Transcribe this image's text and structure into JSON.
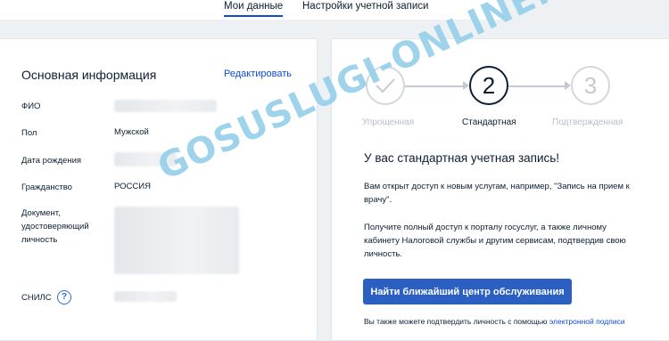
{
  "tabs": [
    {
      "label": "Мои данные",
      "active": true
    },
    {
      "label": "Настройки учетной записи",
      "active": false
    }
  ],
  "basic_info": {
    "title": "Основная информация",
    "edit_label": "Редактировать",
    "rows": [
      {
        "label": "ФИО",
        "value": ""
      },
      {
        "label": "Пол",
        "value": "Мужской"
      },
      {
        "label": "Дата рождения",
        "value": ""
      },
      {
        "label": "Гражданство",
        "value": "РОССИЯ"
      },
      {
        "label": "Документ, удостоверяющий личность",
        "value": ""
      },
      {
        "label": "СНИЛС",
        "value": ""
      }
    ],
    "help_glyph": "?"
  },
  "account_level": {
    "steps": [
      {
        "number": "",
        "label": "Упрощенная",
        "state": "done"
      },
      {
        "number": "2",
        "label": "Стандартная",
        "state": "current"
      },
      {
        "number": "3",
        "label": "Подтвержденная",
        "state": "pending"
      }
    ],
    "status_title": "У вас стандартная учетная запись!",
    "paragraph_1": "Вам открыт доступ к новым услугам, например, \"Запись на прием к врачу\".",
    "paragraph_2": "Получите полный доступ к порталу госуслуг, а также личному кабинету Налоговой службы и другим сервисам, подтвердив свою личность.",
    "button_label": "Найти ближайший центр обслуживания",
    "footnote_text": "Вы также можете подтвердить личность с помощью ",
    "footnote_link": "электронной подписи"
  },
  "watermark": "GOSUSLUGI-ONLINE.RU",
  "colors": {
    "accent": "#0d4cd3",
    "button": "#2b5fc2",
    "background": "#eef1f4",
    "watermark": "#7dc4e4"
  },
  "icons": {
    "step_done": "checkmark-icon",
    "arrow": "arrow-right-icon",
    "help": "question-circle-icon"
  }
}
